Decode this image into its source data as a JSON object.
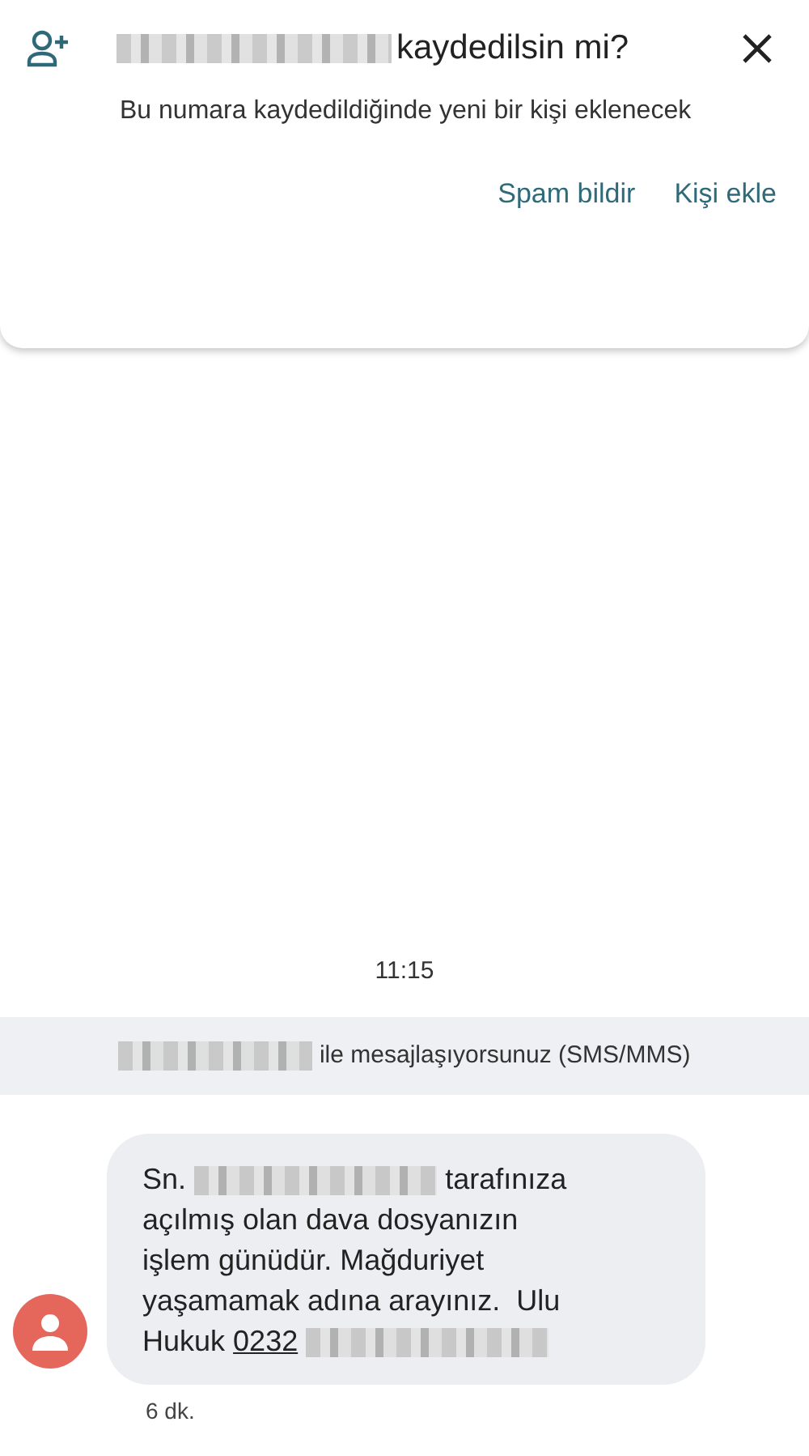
{
  "save_prompt": {
    "title_parts": [
      {
        "kind": "redacted"
      },
      {
        "kind": "text",
        "text": "kaydedilsin mi?"
      }
    ],
    "body": "Bu numara kaydedildiğinde yeni bir kişi eklenecek",
    "actions": [
      "Spam bildir",
      "Kişi ekle"
    ]
  },
  "timestamp": "11:15",
  "info_banner": {
    "parts": [
      {
        "kind": "redacted"
      },
      {
        "kind": "text",
        "text": "ile mesajlaşıyorsunuz (SMS/MMS)"
      }
    ]
  },
  "message": {
    "lines": [
      [
        {
          "kind": "text",
          "text": "Sn."
        },
        {
          "kind": "redacted"
        },
        {
          "kind": "text",
          "text": "tarafınıza"
        }
      ],
      [
        {
          "kind": "text",
          "text": "açılmış olan dava dosyanızın"
        }
      ],
      [
        {
          "kind": "text",
          "text": "işlem günüdür. Mağduriyet"
        }
      ],
      [
        {
          "kind": "text",
          "text": "yaşamamak adına arayınız.  Ulu"
        }
      ],
      [
        {
          "kind": "text",
          "text": "Hukuk"
        },
        {
          "kind": "link",
          "text": "0232"
        },
        {
          "kind": "redacted"
        }
      ]
    ],
    "time": "6 dk."
  }
}
